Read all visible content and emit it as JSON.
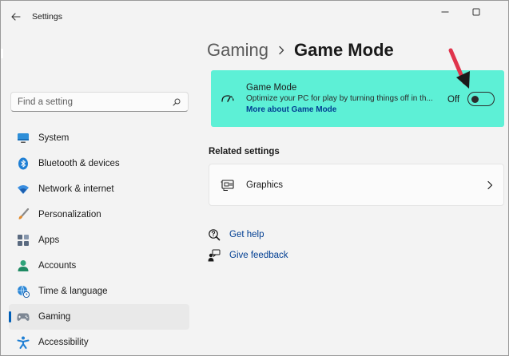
{
  "titlebar": {
    "title": "Settings",
    "back_icon": "arrow-left-icon",
    "controls": [
      "minimize-icon",
      "maximize-icon"
    ]
  },
  "search": {
    "placeholder": "Find a setting",
    "icon": "search-icon"
  },
  "sidebar": {
    "items": [
      {
        "label": "System",
        "icon": "monitor-icon",
        "active": false
      },
      {
        "label": "Bluetooth & devices",
        "icon": "bluetooth-icon",
        "active": false
      },
      {
        "label": "Network & internet",
        "icon": "wifi-icon",
        "active": false
      },
      {
        "label": "Personalization",
        "icon": "brush-icon",
        "active": false
      },
      {
        "label": "Apps",
        "icon": "apps-icon",
        "active": false
      },
      {
        "label": "Accounts",
        "icon": "person-icon",
        "active": false
      },
      {
        "label": "Time & language",
        "icon": "globe-clock-icon",
        "active": false
      },
      {
        "label": "Gaming",
        "icon": "gamepad-icon",
        "active": true
      },
      {
        "label": "Accessibility",
        "icon": "accessibility-icon",
        "active": false
      }
    ]
  },
  "breadcrumb": {
    "parent": "Gaming",
    "current": "Game Mode"
  },
  "game_mode": {
    "title": "Game Mode",
    "description": "Optimize your PC for play by turning things off in th...",
    "link": "More about Game Mode",
    "state_label": "Off",
    "enabled": false,
    "highlight_color": "#5df0d6"
  },
  "related": {
    "heading": "Related settings",
    "items": [
      {
        "label": "Graphics",
        "icon": "graphics-card-icon"
      }
    ]
  },
  "help": {
    "get_help": "Get help",
    "give_feedback": "Give feedback"
  },
  "colors": {
    "accent": "#005fb8",
    "link": "#003e92",
    "annotation_arrow": "#e0344c"
  }
}
